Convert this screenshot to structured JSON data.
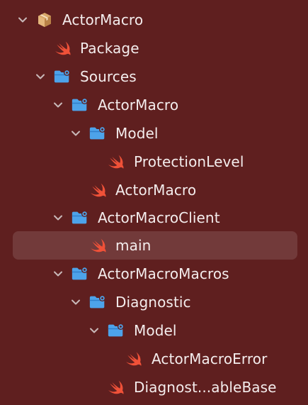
{
  "navigator": {
    "items": [
      {
        "label": "ActorMacro",
        "icon": "package-icon",
        "expandable": true,
        "expanded": true
      },
      {
        "label": "Package",
        "icon": "swift-file-icon"
      },
      {
        "label": "Sources",
        "icon": "folder-gear-icon",
        "expandable": true,
        "expanded": true
      },
      {
        "label": "ActorMacro",
        "icon": "folder-gear-icon",
        "expandable": true,
        "expanded": true
      },
      {
        "label": "Model",
        "icon": "folder-gear-icon",
        "expandable": true,
        "expanded": true
      },
      {
        "label": "ProtectionLevel",
        "icon": "swift-file-icon"
      },
      {
        "label": "ActorMacro",
        "icon": "swift-file-icon"
      },
      {
        "label": "ActorMacroClient",
        "icon": "folder-gear-icon",
        "expandable": true,
        "expanded": true
      },
      {
        "label": "main",
        "icon": "swift-file-icon",
        "selected": true
      },
      {
        "label": "ActorMacroMacros",
        "icon": "folder-gear-icon",
        "expandable": true,
        "expanded": true
      },
      {
        "label": "Diagnostic",
        "icon": "folder-gear-icon",
        "expandable": true,
        "expanded": true
      },
      {
        "label": "Model",
        "icon": "folder-gear-icon",
        "expandable": true,
        "expanded": true
      },
      {
        "label": "ActorMacroError",
        "icon": "swift-file-icon"
      },
      {
        "label": "Diagnost...ableBase",
        "icon": "swift-file-icon"
      }
    ]
  },
  "colors": {
    "background": "#5f1f1f",
    "selection": "rgba(255,255,255,0.12)",
    "folder": "#4da3ea",
    "swift": "#f05138",
    "package": "#d9a86a",
    "chevron": "#c9b9b9",
    "text": "#f4eded"
  }
}
